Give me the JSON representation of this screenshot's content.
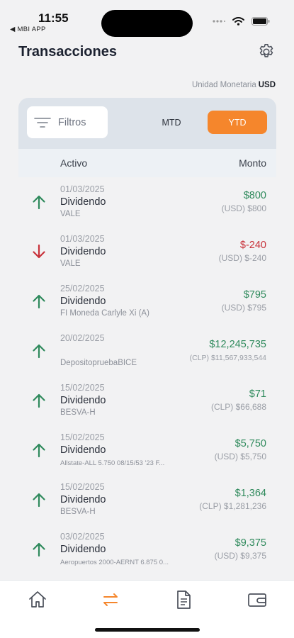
{
  "status": {
    "time": "11:55",
    "back_app": "◀ MBI APP"
  },
  "header": {
    "title": "Transacciones"
  },
  "currency": {
    "label": "Unidad Monetaria",
    "value": "USD"
  },
  "filters": {
    "label": "Filtros",
    "tabs": [
      "MTD",
      "YTD"
    ],
    "active_tab": "YTD"
  },
  "table": {
    "col_asset": "Activo",
    "col_amount": "Monto"
  },
  "transactions": [
    {
      "date": "01/03/2025",
      "type": "Dividendo",
      "asset": "VALE",
      "amount": "$800",
      "sub": "(USD) $800",
      "direction": "up"
    },
    {
      "date": "01/03/2025",
      "type": "Dividendo",
      "asset": "VALE",
      "amount": "$-240",
      "sub": "(USD) $-240",
      "direction": "down"
    },
    {
      "date": "25/02/2025",
      "type": "Dividendo",
      "asset": "FI Moneda Carlyle Xi (A)",
      "amount": "$795",
      "sub": "(USD) $795",
      "direction": "up"
    },
    {
      "date": "20/02/2025",
      "type": "",
      "asset": "DepositopruebaBICE",
      "amount": "$12,245,735",
      "sub": "(CLP) $11,567,933,544",
      "direction": "up"
    },
    {
      "date": "15/02/2025",
      "type": "Dividendo",
      "asset": "BESVA-H",
      "amount": "$71",
      "sub": "(CLP) $66,688",
      "direction": "up"
    },
    {
      "date": "15/02/2025",
      "type": "Dividendo",
      "asset": "Allstate-ALL 5.750 08/15/53 '23 F...",
      "amount": "$5,750",
      "sub": "(USD) $5,750",
      "direction": "up"
    },
    {
      "date": "15/02/2025",
      "type": "Dividendo",
      "asset": "BESVA-H",
      "amount": "$1,364",
      "sub": "(CLP) $1,281,236",
      "direction": "up"
    },
    {
      "date": "03/02/2025",
      "type": "Dividendo",
      "asset": "Aeropuertos 2000-AERNT 6.875 0...",
      "amount": "$9,375",
      "sub": "(USD) $9,375",
      "direction": "up"
    }
  ],
  "colors": {
    "accent": "#f5862c",
    "positive": "#2f8a5c",
    "negative": "#c8323a"
  },
  "tabbar": {
    "icons": [
      "home-icon",
      "transfer-icon",
      "document-icon",
      "wallet-icon"
    ],
    "active": "transfer-icon"
  }
}
